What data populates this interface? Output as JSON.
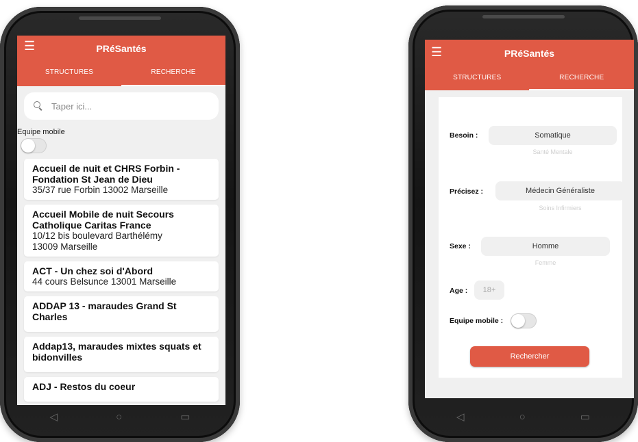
{
  "app": {
    "title": "PRéSantés",
    "tabs": [
      {
        "label": "STRUCTURES"
      },
      {
        "label": "RECHERCHE"
      }
    ]
  },
  "structures_screen": {
    "search": {
      "placeholder": "Taper ici..."
    },
    "mobile_team_label": "Equipe mobile",
    "mobile_team_on": false,
    "items": [
      {
        "name": "Accueil de nuit et CHRS Forbin - Fondation St Jean de Dieu",
        "address": "35/37 rue Forbin 13002 Marseille"
      },
      {
        "name": "Accueil Mobile de nuit Secours Catholique Caritas France",
        "address": "10/12 bis boulevard Barthélémy\n13009 Marseille"
      },
      {
        "name": "ACT - Un chez soi d'Abord",
        "address": "44 cours Belsunce 13001 Marseille"
      },
      {
        "name": "ADDAP 13 - maraudes Grand St Charles",
        "address": ""
      },
      {
        "name": "Addap13, maraudes mixtes squats et bidonvilles",
        "address": ""
      },
      {
        "name": "ADJ - Restos du coeur",
        "address": ""
      }
    ]
  },
  "search_screen": {
    "need": {
      "label": "Besoin :",
      "selected": "Somatique",
      "next": "Santé Mentale"
    },
    "specify": {
      "label": "Précisez :",
      "selected": "Médecin Généraliste",
      "next": "Soins Infirmiers"
    },
    "sex": {
      "label": "Sexe :",
      "selected": "Homme",
      "next": "Femme"
    },
    "age": {
      "label": "Age :",
      "value": "18+"
    },
    "mobile_team": {
      "label": "Equipe mobile :",
      "on": false
    },
    "submit_label": "Rechercher"
  },
  "colors": {
    "brand": "#e05a45",
    "background": "#f0f0f0"
  },
  "icons": {
    "menu": "hamburger-menu-icon",
    "search": "search-icon"
  }
}
